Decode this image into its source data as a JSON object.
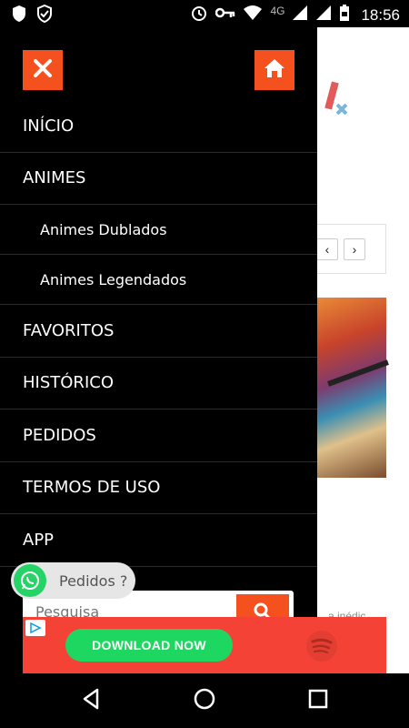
{
  "status_bar": {
    "time": "18:56",
    "network": "4G",
    "icons": [
      "shield-icon",
      "shield-check-icon",
      "alarm-icon",
      "vpn-key-icon",
      "wifi-icon",
      "signal-icon",
      "battery-icon"
    ]
  },
  "drawer": {
    "close_icon": "close-icon",
    "home_icon": "home-icon",
    "menu": [
      {
        "label": "INÍCIO",
        "sub": false
      },
      {
        "label": "ANIMES",
        "sub": false
      },
      {
        "label": "Animes Dublados",
        "sub": true
      },
      {
        "label": "Animes Legendados",
        "sub": true
      },
      {
        "label": "FAVORITOS",
        "sub": false
      },
      {
        "label": "HISTÓRICO",
        "sub": false
      },
      {
        "label": "PEDIDOS",
        "sub": false
      },
      {
        "label": "TERMOS DE USO",
        "sub": false
      },
      {
        "label": "APP",
        "sub": false
      }
    ],
    "search": {
      "placeholder": "Pesquisa"
    }
  },
  "whatsapp": {
    "label": "Pedidos ?"
  },
  "ad": {
    "cta": "DOWNLOAD NOW",
    "brand_icon": "spotify-icon"
  },
  "background_page": {
    "pager_prev": "‹",
    "pager_next": "›",
    "footer_text": "a inédic"
  },
  "colors": {
    "accent": "#f4511e",
    "whatsapp": "#25d366",
    "ad_bg": "#f44336",
    "spotify_green": "#1ed760"
  }
}
